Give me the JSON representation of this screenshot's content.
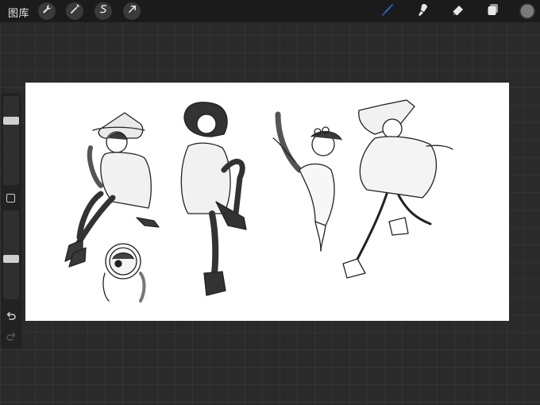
{
  "topbar": {
    "gallery_label": "图库",
    "tools_left": [
      "wrench-icon",
      "magic-wand-icon",
      "selection-icon",
      "transform-arrow-icon"
    ],
    "tools_right": [
      "brush-icon",
      "smudge-icon",
      "eraser-icon",
      "layers-icon"
    ],
    "active_tool": "brush-icon",
    "active_color": "#2f6ae0",
    "current_color": "#7a7a7a"
  },
  "sidebar": {
    "brush_size_level": 0.75,
    "opacity_level": 0.45,
    "controls": [
      "brush-size-slider",
      "modify-button",
      "opacity-slider",
      "undo-icon",
      "redo-icon"
    ]
  },
  "canvas": {
    "background": "#ffffff",
    "content": "sketch-figures"
  }
}
